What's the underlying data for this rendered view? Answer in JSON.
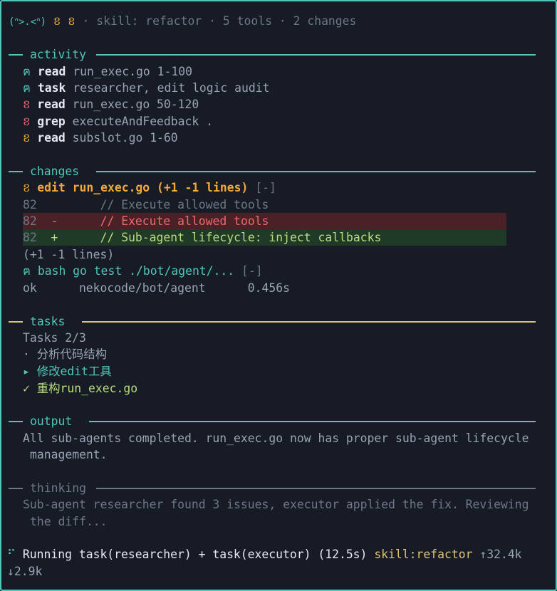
{
  "header": {
    "face": "(ᐢ>.<ᐢ)",
    "glyph": "ខ ខ",
    "sep1": "·",
    "skill": "skill: refactor",
    "sep2": "·",
    "tools": "5 tools",
    "sep3": "·",
    "changes": "2 changes"
  },
  "sections": {
    "activity": "activity",
    "changes": "changes",
    "tasks": "tasks",
    "output": "output",
    "thinking": "thinking"
  },
  "activity": [
    {
      "icon": "ฅ",
      "verb": "read",
      "arg": "run_exec.go 1-100"
    },
    {
      "icon": "ฅ",
      "verb": "task",
      "arg": "researcher, edit logic audit"
    },
    {
      "icon": "ខ",
      "verb": "read",
      "arg": "run_exec.go 50-120"
    },
    {
      "icon": "ខ",
      "verb": "grep",
      "arg": "executeAndFeedback ."
    },
    {
      "icon": "ខ",
      "verb": "read",
      "arg": "subslot.go 1-60"
    }
  ],
  "changes": {
    "edit_icon": "ខ",
    "edit_title": "edit run_exec.go (+1 -1 lines)",
    "edit_toggle": "[-]",
    "diff": [
      {
        "num": "82",
        "sign": " ",
        "text": "    // Execute allowed tools"
      },
      {
        "num": "82",
        "sign": "-",
        "text": "    // Execute allowed tools"
      },
      {
        "num": "82",
        "sign": "+",
        "text": "    // Sub-agent lifecycle: inject callbacks"
      }
    ],
    "summary": "(+1 -1 lines)",
    "bash_icon": "ฅ",
    "bash_title": "bash go test ./bot/agent/...",
    "bash_toggle": "[-]",
    "bash_result": "ok      nekocode/bot/agent      0.456s"
  },
  "tasks": {
    "count": "Tasks 2/3",
    "items": [
      {
        "marker": "·",
        "text": "分析代码结构"
      },
      {
        "marker": "▸",
        "text": "修改edit工具"
      },
      {
        "marker": "✓",
        "text": "重构run_exec.go"
      }
    ]
  },
  "output": {
    "line1": "All sub-agents completed. run_exec.go now has proper sub-agent lifecycle",
    "line2": "management."
  },
  "thinking": {
    "line1": "Sub-agent researcher found 3 issues, executor applied the fix. Reviewing",
    "line2": "the diff..."
  },
  "status": {
    "spinner": "⠋",
    "running": "Running task(researcher) + task(executor) (12.5s)",
    "skill": "skill:refactor",
    "tokens_up": "↑32.4k",
    "tokens_down": "↓2.9k"
  },
  "colors": {
    "accent": "#4fc7b9",
    "warning": "#f2a93b",
    "error": "#f06a6a",
    "success": "#b8dc7c",
    "background": "#161b26"
  }
}
